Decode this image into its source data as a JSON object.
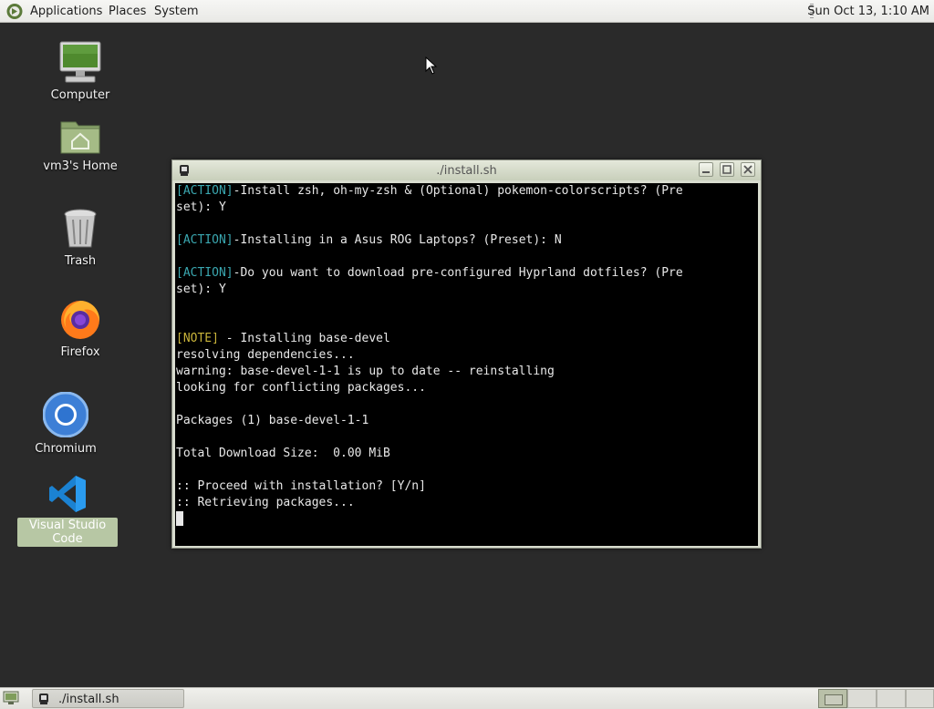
{
  "top_panel": {
    "menus": [
      "Applications",
      "Places",
      "System"
    ],
    "clock": "Sun Oct 13,  1:10 AM"
  },
  "desktop_icons": [
    {
      "label": "Computer",
      "icon": "computer-icon"
    },
    {
      "label": "vm3's Home",
      "icon": "home-folder-icon"
    },
    {
      "label": "Trash",
      "icon": "trash-icon"
    },
    {
      "label": "Firefox",
      "icon": "firefox-icon"
    },
    {
      "label": "Chromium",
      "icon": "chromium-icon"
    },
    {
      "label": "Visual Studio Code",
      "icon": "vscode-icon",
      "selected": true
    }
  ],
  "window": {
    "title": "./install.sh",
    "buttons": [
      "minimize",
      "maximize",
      "close"
    ]
  },
  "terminal": {
    "lines": [
      {
        "tag": "[ACTION]",
        "tag_type": "action",
        "text": "-Install zsh, oh-my-zsh & (Optional) pokemon-colorscripts? (Pre"
      },
      {
        "tag": "",
        "tag_type": "",
        "text": "set): Y"
      },
      {
        "tag": "",
        "tag_type": "",
        "text": ""
      },
      {
        "tag": "[ACTION]",
        "tag_type": "action",
        "text": "-Installing in a Asus ROG Laptops? (Preset): N"
      },
      {
        "tag": "",
        "tag_type": "",
        "text": ""
      },
      {
        "tag": "[ACTION]",
        "tag_type": "action",
        "text": "-Do you want to download pre-configured Hyprland dotfiles? (Pre"
      },
      {
        "tag": "",
        "tag_type": "",
        "text": "set): Y"
      },
      {
        "tag": "",
        "tag_type": "",
        "text": ""
      },
      {
        "tag": "",
        "tag_type": "",
        "text": ""
      },
      {
        "tag": "[NOTE]",
        "tag_type": "note",
        "text": " - Installing base-devel"
      },
      {
        "tag": "",
        "tag_type": "",
        "text": "resolving dependencies..."
      },
      {
        "tag": "",
        "tag_type": "",
        "text": "warning: base-devel-1-1 is up to date -- reinstalling"
      },
      {
        "tag": "",
        "tag_type": "",
        "text": "looking for conflicting packages..."
      },
      {
        "tag": "",
        "tag_type": "",
        "text": ""
      },
      {
        "tag": "",
        "tag_type": "",
        "text": "Packages (1) base-devel-1-1"
      },
      {
        "tag": "",
        "tag_type": "",
        "text": ""
      },
      {
        "tag": "",
        "tag_type": "",
        "text": "Total Download Size:  0.00 MiB"
      },
      {
        "tag": "",
        "tag_type": "",
        "text": ""
      },
      {
        "tag": "",
        "tag_type": "",
        "text": ":: Proceed with installation? [Y/n]"
      },
      {
        "tag": "",
        "tag_type": "",
        "text": ":: Retrieving packages..."
      }
    ],
    "colors": {
      "action": "#3aa7b0",
      "note": "#c9b43a",
      "text": "#e8e8e8",
      "background": "#000000"
    }
  },
  "bottom_panel": {
    "task_label": "./install.sh",
    "workspaces": 4,
    "active_workspace": 1
  }
}
